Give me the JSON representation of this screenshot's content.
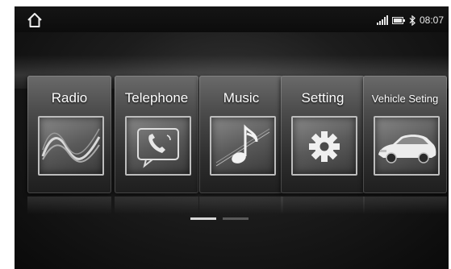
{
  "statusbar": {
    "home_icon": "home-icon",
    "signal_icon": "signal-icon",
    "battery_icon": "battery-icon",
    "bluetooth_icon": "bluetooth-icon",
    "time": "08:07"
  },
  "menu": {
    "items": [
      {
        "label": "Radio",
        "icon": "radio-wave-icon"
      },
      {
        "label": "Telephone",
        "icon": "telephone-icon"
      },
      {
        "label": "Music",
        "icon": "music-note-icon"
      },
      {
        "label": "Setting",
        "icon": "gear-icon"
      },
      {
        "label": "Vehicle Seting",
        "icon": "car-icon"
      }
    ]
  },
  "pager": {
    "pages": 2,
    "current": 1
  }
}
